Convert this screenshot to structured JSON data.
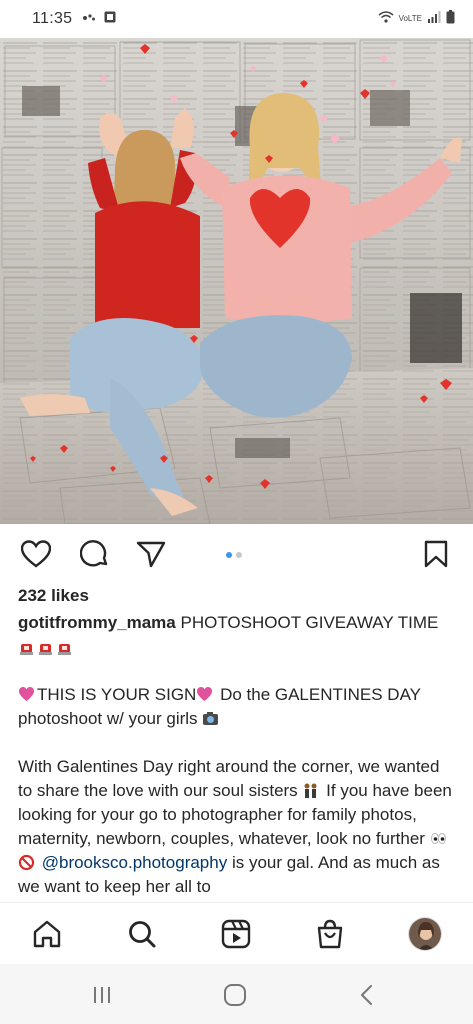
{
  "status_bar": {
    "time": "11:35",
    "network_label": "VoLTE",
    "icons": [
      "messenger-icon",
      "photo-icon",
      "wifi-icon",
      "signal-icon",
      "battery-icon"
    ]
  },
  "post": {
    "image_alt": "Two women throwing heart confetti",
    "carousel": {
      "count": 2,
      "active_index": 0
    },
    "likes": "232 likes",
    "caption": {
      "username": "gotitfrommy_mama",
      "headline": "PHOTOSHOOT GIVEAWAY TIME",
      "para2_before": "THIS IS YOUR SIGN",
      "para2_after": "Do the GALENTINES DAY photoshoot w/ your girls",
      "para3_part1": "With Galentines Day right around the corner, we wanted to share the love with our soul sisters",
      "para3_part2": "If you have been looking for your go to photographer for family photos, maternity, newborn, couples, whatever, look no further",
      "mention": "@brooksco.photography",
      "para3_part3": "is your gal. And as much as we want to keep her all to"
    }
  },
  "actions": {
    "like_icon": "heart-icon",
    "comment_icon": "comment-icon",
    "share_icon": "send-icon",
    "save_icon": "bookmark-icon"
  },
  "bottom_nav": [
    "home-icon",
    "search-icon",
    "reels-icon",
    "shop-icon",
    "profile-avatar"
  ],
  "system_nav": [
    "recents-button",
    "home-button",
    "back-button"
  ],
  "colors": {
    "accent_blue": "#3897f0",
    "mention": "#00376b",
    "text": "#262626",
    "heart_red": "#e3342b"
  }
}
